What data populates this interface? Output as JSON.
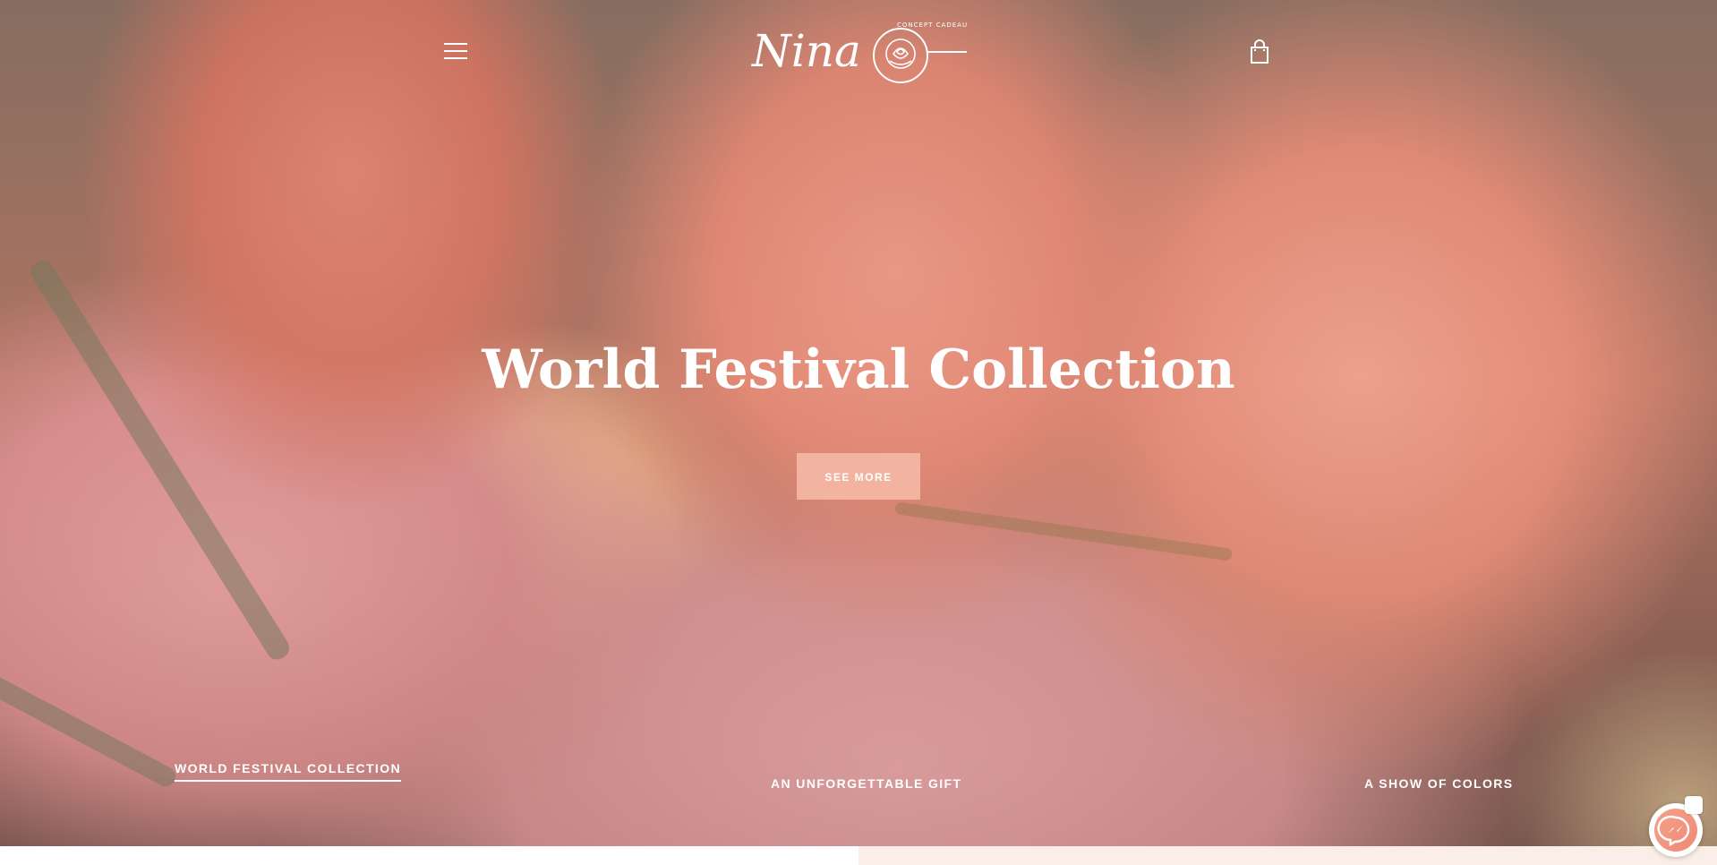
{
  "header": {
    "menu_icon": "hamburger-menu-icon",
    "logo": {
      "script_text": "Nina",
      "tagline": "CONCEPT CADEAU",
      "icon": "rose-icon"
    },
    "cart_icon": "shopping-bag-icon"
  },
  "hero": {
    "title": "World Festival Collection",
    "cta_label": "SEE MORE"
  },
  "slides": {
    "items": [
      {
        "label": "WORLD FESTIVAL COLLECTION",
        "active": true
      },
      {
        "label": "AN UNFORGETTABLE GIFT",
        "active": false
      },
      {
        "label": "A SHOW OF COLORS",
        "active": false
      }
    ]
  },
  "chat": {
    "icon": "messenger-icon"
  },
  "colors": {
    "cta_background": "#f3b3a1",
    "text": "#ffffff",
    "footer_strip_right": "#fbeee8"
  }
}
